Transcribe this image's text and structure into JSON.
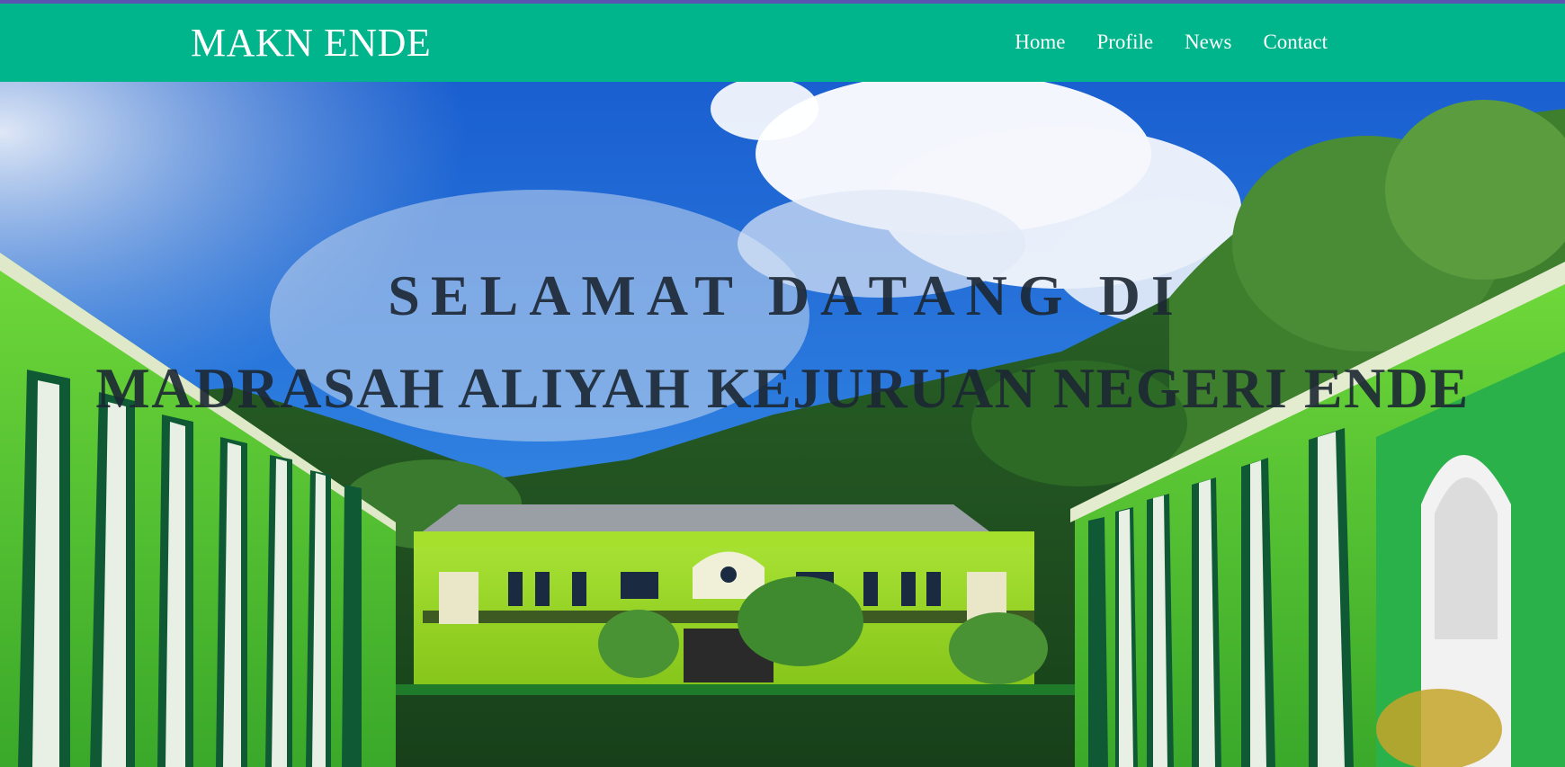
{
  "site": {
    "brand": "MAKN ENDE"
  },
  "nav": {
    "items": [
      {
        "label": "Home"
      },
      {
        "label": "Profile"
      },
      {
        "label": "News"
      },
      {
        "label": "Contact"
      }
    ]
  },
  "hero": {
    "line1": "SELAMAT DATANG DI",
    "line2": "MADRASAH ALIYAH KEJURUAN NEGERI ENDE"
  },
  "colors": {
    "top_strip": "#5a55b0",
    "navbar": "#00b58b",
    "nav_text": "#ffffff",
    "hero_text": "#1c2733"
  }
}
